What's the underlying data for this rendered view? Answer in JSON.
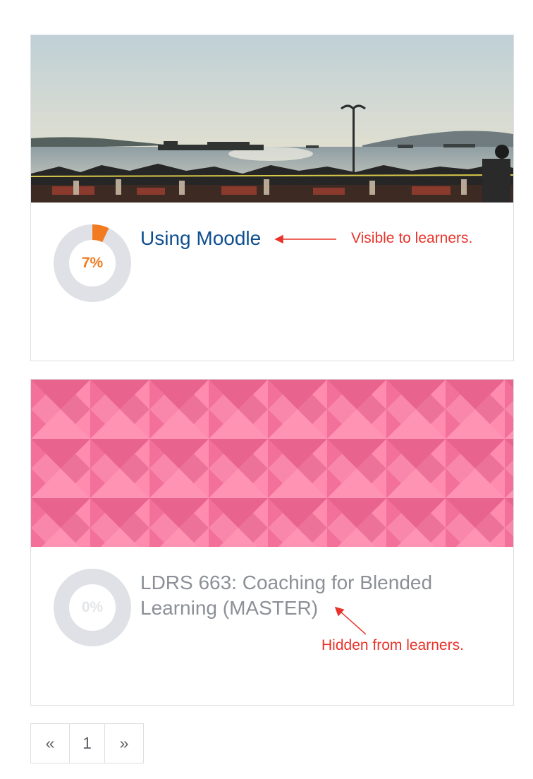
{
  "courses": [
    {
      "name": "Using Moodle",
      "progress_value": 0.07,
      "progress_text": "7%",
      "name_color": "#0f4f8f",
      "progress_color": "#f27b22",
      "image": "beach-photo",
      "annotation": "Visible to learners."
    },
    {
      "name": "LDRS 663: Coaching for Blended Learning (MASTER)",
      "progress_value": 0.0,
      "progress_text": "0%",
      "name_color": "#8c9096",
      "progress_color": "#f27b22",
      "image": "pink-geometric-pattern",
      "annotation": "Hidden from learners."
    }
  ],
  "colors": {
    "annotation": "#e8322a",
    "ring_track": "#dfe1e6",
    "pink_pattern": "#ff7fa6"
  },
  "pagination": {
    "prev": "«",
    "page": "1",
    "next": "»"
  }
}
